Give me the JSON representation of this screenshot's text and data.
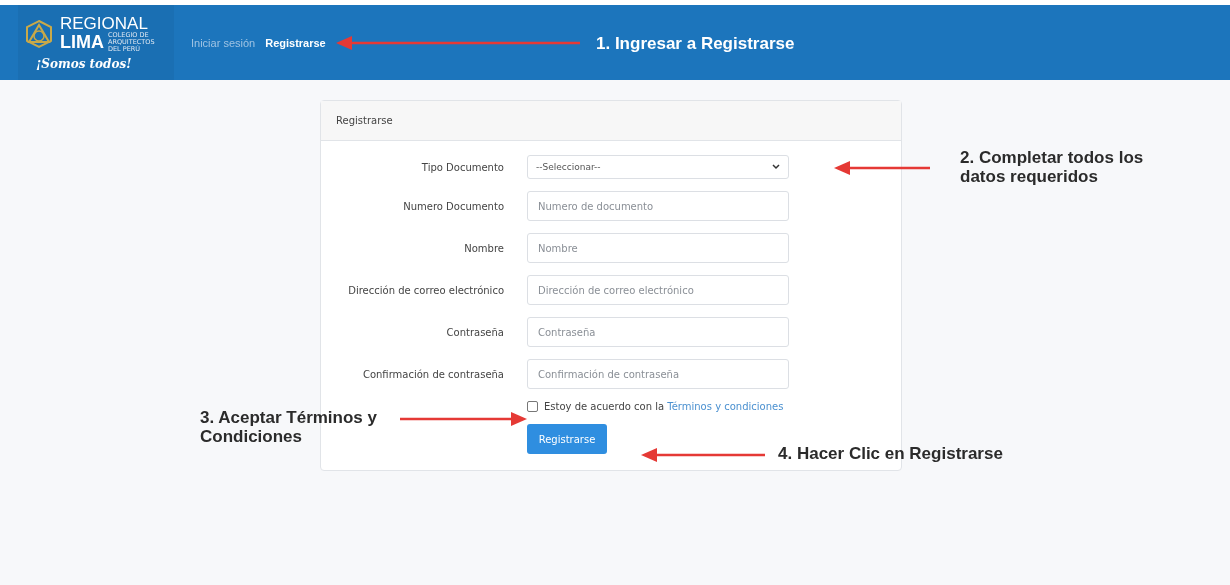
{
  "navbar": {
    "logo": {
      "line_1": "REGIONAL",
      "line_2": "LIMA",
      "small_text": "COLEGIO DE ARQUITECTOS DEL PERÚ",
      "slogan": "¡Somos todos!"
    },
    "links": [
      {
        "label": "Iniciar sesión",
        "selected": false
      },
      {
        "label": "Registrarse",
        "selected": true
      }
    ]
  },
  "card": {
    "title": "Registrarse",
    "fields": [
      {
        "label": "Tipo Documento",
        "kind": "select",
        "value": "--Seleccionar--"
      },
      {
        "label": "Numero Documento",
        "kind": "text",
        "placeholder": "Numero de documento"
      },
      {
        "label": "Nombre",
        "kind": "text",
        "placeholder": "Nombre"
      },
      {
        "label": "Dirección de correo electrónico",
        "kind": "text",
        "placeholder": "Dirección de correo electrónico"
      },
      {
        "label": "Contraseña",
        "kind": "text",
        "placeholder": "Contraseña"
      },
      {
        "label": "Confirmación de contraseña",
        "kind": "text",
        "placeholder": "Confirmación de contraseña"
      }
    ],
    "terms": {
      "checked": false,
      "text": "Estoy de acuerdo con la",
      "link": "Términos y condiciones"
    },
    "submit": "Registrarse"
  },
  "annotations": [
    {
      "text": "1. Ingresar a Registrarse",
      "on_dark": true
    },
    {
      "text": "2. Completar todos los datos requeridos",
      "on_dark": false
    },
    {
      "text": "3. Aceptar Términos y Condiciones",
      "on_dark": false
    },
    {
      "text": "4. Hacer Clic en Registrarse",
      "on_dark": false
    }
  ]
}
